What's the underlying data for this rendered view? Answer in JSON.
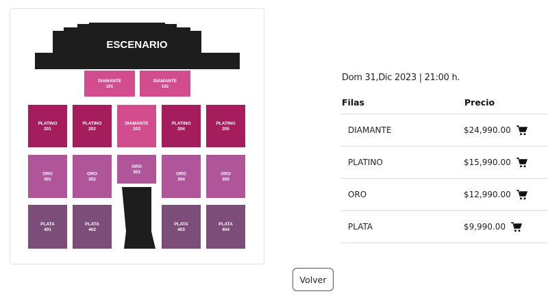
{
  "venue_map": {
    "stage_label": "ESCENARIO",
    "zones": [
      {
        "id": "z101",
        "name": "DIAMANTE",
        "number": "101",
        "color": "#d24d8e"
      },
      {
        "id": "z102",
        "name": "DIAMANTE",
        "number": "102",
        "color": "#d24d8e"
      },
      {
        "id": "z201",
        "name": "PLATINO",
        "number": "201",
        "color": "#a51d5d"
      },
      {
        "id": "z202",
        "name": "PLATINO",
        "number": "202",
        "color": "#a51d5d"
      },
      {
        "id": "z203",
        "name": "DIAMANTE",
        "number": "203",
        "color": "#d24d8e"
      },
      {
        "id": "z204",
        "name": "PLATINO",
        "number": "204",
        "color": "#a51d5d"
      },
      {
        "id": "z205",
        "name": "PLATINO",
        "number": "205",
        "color": "#a51d5d"
      },
      {
        "id": "z301",
        "name": "ORO",
        "number": "301",
        "color": "#b1559a"
      },
      {
        "id": "z302",
        "name": "ORO",
        "number": "302",
        "color": "#b1559a"
      },
      {
        "id": "z303",
        "name": "ORO",
        "number": "303",
        "color": "#b1559a"
      },
      {
        "id": "z304",
        "name": "ORO",
        "number": "304",
        "color": "#b1559a"
      },
      {
        "id": "z305",
        "name": "ORO",
        "number": "305",
        "color": "#b1559a"
      },
      {
        "id": "z401",
        "name": "PLATA",
        "number": "401",
        "color": "#7b4d78"
      },
      {
        "id": "z402",
        "name": "PLATA",
        "number": "402",
        "color": "#7b4d78"
      },
      {
        "id": "z403",
        "name": "PLATA",
        "number": "403",
        "color": "#7b4d78"
      },
      {
        "id": "z404",
        "name": "PLATA",
        "number": "404",
        "color": "#7b4d78"
      }
    ],
    "stage_color": "#1d1d1d"
  },
  "event": {
    "date_time": "Dom 31,Dic 2023 | 21:00 h."
  },
  "table": {
    "headers": {
      "rows": "Filas",
      "price": "Precio"
    },
    "rows": [
      {
        "zone": "DIAMANTE",
        "price": "$24,990.00",
        "icon": "cart-icon"
      },
      {
        "zone": "PLATINO",
        "price": "$15,990.00",
        "icon": "cart-icon"
      },
      {
        "zone": "ORO",
        "price": "$12,990.00",
        "icon": "cart-icon"
      },
      {
        "zone": "PLATA",
        "price": "$9,990.00",
        "icon": "cart-icon"
      }
    ]
  },
  "actions": {
    "back_label": "Volver"
  }
}
